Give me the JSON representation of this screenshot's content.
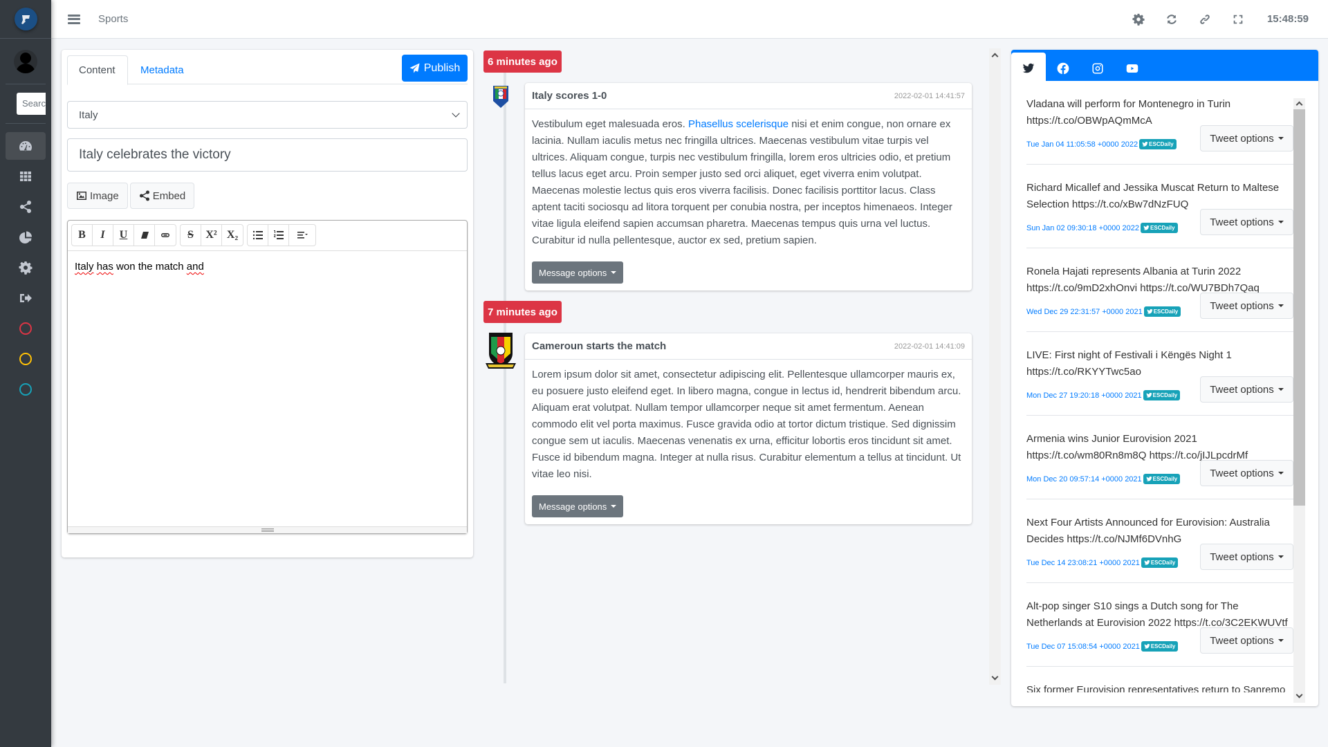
{
  "app": {
    "title": "Sports",
    "clock": "15:48:59"
  },
  "sidebar": {
    "search_placeholder": "Search",
    "nav": [
      {
        "icon": "dashboard-icon",
        "active": true
      },
      {
        "icon": "grid-icon"
      },
      {
        "icon": "share-icon"
      },
      {
        "icon": "pie-chart-icon"
      },
      {
        "icon": "gear-icon"
      },
      {
        "icon": "sign-out-icon"
      }
    ],
    "status_circles": [
      {
        "name": "status-circle-red",
        "color": "#dc3545"
      },
      {
        "name": "status-circle-yellow",
        "color": "#ffc107"
      },
      {
        "name": "status-circle-teal",
        "color": "#17a2b8"
      }
    ]
  },
  "header": {
    "icons": [
      "gear-icon",
      "refresh-icon",
      "link-icon",
      "fullscreen-icon"
    ]
  },
  "editor": {
    "tabs": [
      {
        "label": "Content",
        "active": true
      },
      {
        "label": "Metadata"
      }
    ],
    "publish_label": "Publish",
    "team_select": {
      "value": "Italy"
    },
    "title_value": "Italy celebrates the victory",
    "media_buttons": {
      "image": "Image",
      "embed": "Embed"
    },
    "toolbar": {
      "bold": "B",
      "italic": "I",
      "underline": "U",
      "strikethrough": "S",
      "superscript": "X²",
      "subscript": "X₂"
    },
    "body_words": [
      "Italy",
      "has",
      "won the match",
      "and"
    ]
  },
  "timeline": {
    "entries": [
      {
        "badge": "6 minutes ago",
        "team": "Italy",
        "title": "Italy scores 1-0",
        "timestamp": "2022-02-01 14:41:57",
        "body_before_link": "Vestibulum eget malesuada eros. ",
        "link_text": "Phasellus scelerisque",
        "body_after_link": " nisi et enim congue, non ornare ex lacinia. Nullam iaculis metus nec fringilla ultrices. Maecenas vestibulum vitae turpis vel ultrices. Aliquam congue, turpis nec vestibulum fringilla, lorem eros ultricies odio, et pretium tellus lacus eget arcu. Proin semper justo sed orci aliquet, eget viverra enim volutpat. Maecenas molestie lectus quis eros viverra facilisis. Donec facilisis porttitor lacus. Class aptent taciti sociosqu ad litora torquent per conubia nostra, per inceptos himenaeos. Integer vitae ligula eleifend sapien accumsan pharetra. Maecenas tempus quis urna vel luctus. Curabitur id nulla pellentesque, auctor ex sed, pretium sapien.",
        "options_label": "Message options"
      },
      {
        "badge": "7 minutes ago",
        "team": "Cameroun",
        "title": "Cameroun starts the match",
        "timestamp": "2022-02-01 14:41:09",
        "body": "Lorem ipsum dolor sit amet, consectetur adipiscing elit. Pellentesque ullamcorper mauris ex, eu posuere justo eleifend eget. In libero magna, congue in lectus id, hendrerit bibendum arcu. Aliquam erat volutpat. Nullam tempor ullamcorper neque sit amet fermentum. Aenean commodo elit vel porta maximus. Fusce gravida odio at tortor dictum tristique. Sed dignissim congue sem ut iaculis. Maecenas venenatis ex urna, efficitur lobortis eros tincidunt sit amet. Fusce id bibendum magna. Integer at nulla risus. Curabitur elementum a tellus at tincidunt. Ut vitae leo nisi.",
        "options_label": "Message options"
      }
    ]
  },
  "social": {
    "tabs": [
      {
        "icon": "twitter-icon",
        "active": true
      },
      {
        "icon": "facebook-icon"
      },
      {
        "icon": "instagram-icon"
      },
      {
        "icon": "youtube-icon"
      }
    ],
    "account_badge": "ESCDaily",
    "options_label": "Tweet options",
    "tweets": [
      {
        "text": "Vladana will perform for Montenegro in Turin https://t.co/OBWpAQmMcA",
        "date": "Tue Jan 04 11:05:58 +0000 2022"
      },
      {
        "text": "Richard Micallef and Jessika Muscat Return to Maltese Selection https://t.co/xBw7dNzFUQ",
        "date": "Sun Jan 02 09:30:18 +0000 2022"
      },
      {
        "text": "Ronela Hajati represents Albania at Turin 2022 https://t.co/9mD2xhOnvi https://t.co/WU7BDh7Qaq",
        "date": "Wed Dec 29 22:31:57 +0000 2021"
      },
      {
        "text": "LIVE: First night of Festivali i Këngës Night 1 https://t.co/RKYYTwc5ao",
        "date": "Mon Dec 27 19:20:18 +0000 2021"
      },
      {
        "text": "Armenia wins Junior Eurovision 2021 https://t.co/wm80Rn8m8Q https://t.co/jIJLpcdrMf",
        "date": "Mon Dec 20 09:57:14 +0000 2021"
      },
      {
        "text": "Next Four Artists Announced for Eurovision: Australia Decides https://t.co/NJMf6DVnhG",
        "date": "Tue Dec 14 23:08:21 +0000 2021"
      },
      {
        "text": "Alt-pop singer S10 sings a Dutch song for The Netherlands at Eurovision 2022 https://t.co/3C2EKWUVtf",
        "date": "Tue Dec 07 15:08:54 +0000 2021"
      },
      {
        "text": "Six former Eurovision representatives return to Sanremo",
        "date": ""
      }
    ]
  }
}
